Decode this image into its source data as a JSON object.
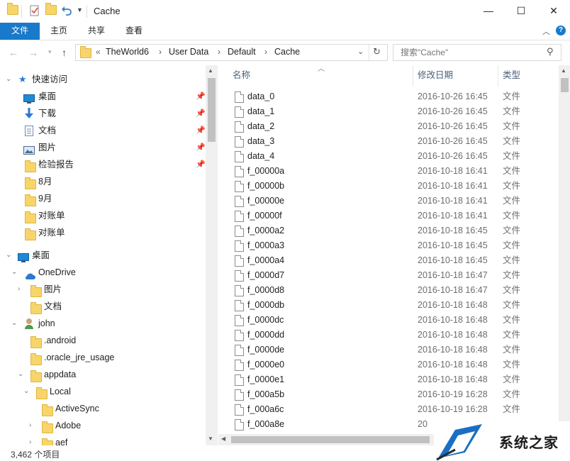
{
  "window": {
    "title": "Cache",
    "controls": {
      "minimize": "—",
      "maximize": "☐",
      "close": "✕"
    }
  },
  "ribbon": {
    "tabs": [
      "文件",
      "主页",
      "共享",
      "查看"
    ],
    "expand_icon": "chevron-up-icon",
    "help_icon": "help-icon"
  },
  "address": {
    "overflow": "«",
    "breadcrumbs": [
      "TheWorld6",
      "User Data",
      "Default",
      "Cache"
    ],
    "search_placeholder": "搜索\"Cache\""
  },
  "nav": {
    "quick_access": {
      "label": "快速访问",
      "items": [
        {
          "label": "桌面",
          "icon": "desktop-icon",
          "pinned": true
        },
        {
          "label": "下载",
          "icon": "download-icon",
          "pinned": true
        },
        {
          "label": "文档",
          "icon": "document-icon",
          "pinned": true
        },
        {
          "label": "图片",
          "icon": "picture-icon",
          "pinned": true
        },
        {
          "label": "检验报告",
          "icon": "folder-icon",
          "pinned": true
        },
        {
          "label": "8月",
          "icon": "folder-icon",
          "pinned": false
        },
        {
          "label": "9月",
          "icon": "folder-icon",
          "pinned": false
        },
        {
          "label": "对账单",
          "icon": "folder-icon",
          "pinned": false
        },
        {
          "label": "对账单",
          "icon": "folder-icon",
          "pinned": false
        }
      ]
    },
    "desktop": {
      "label": "桌面"
    },
    "onedrive": {
      "label": "OneDrive",
      "children": [
        "图片",
        "文档"
      ]
    },
    "user": {
      "label": "john"
    },
    "user_children": [
      ".android",
      ".oracle_jre_usage",
      "appdata"
    ],
    "local": {
      "label": "Local"
    },
    "local_children": [
      "ActiveSync",
      "Adobe",
      "aef"
    ]
  },
  "content": {
    "columns": {
      "name": "名称",
      "date": "修改日期",
      "type": "类型"
    },
    "files": [
      {
        "name": "data_0",
        "date": "2016-10-26 16:45",
        "type": "文件"
      },
      {
        "name": "data_1",
        "date": "2016-10-26 16:45",
        "type": "文件"
      },
      {
        "name": "data_2",
        "date": "2016-10-26 16:45",
        "type": "文件"
      },
      {
        "name": "data_3",
        "date": "2016-10-26 16:45",
        "type": "文件"
      },
      {
        "name": "data_4",
        "date": "2016-10-26 16:45",
        "type": "文件"
      },
      {
        "name": "f_00000a",
        "date": "2016-10-18 16:41",
        "type": "文件"
      },
      {
        "name": "f_00000b",
        "date": "2016-10-18 16:41",
        "type": "文件"
      },
      {
        "name": "f_00000e",
        "date": "2016-10-18 16:41",
        "type": "文件"
      },
      {
        "name": "f_00000f",
        "date": "2016-10-18 16:41",
        "type": "文件"
      },
      {
        "name": "f_0000a2",
        "date": "2016-10-18 16:45",
        "type": "文件"
      },
      {
        "name": "f_0000a3",
        "date": "2016-10-18 16:45",
        "type": "文件"
      },
      {
        "name": "f_0000a4",
        "date": "2016-10-18 16:45",
        "type": "文件"
      },
      {
        "name": "f_0000d7",
        "date": "2016-10-18 16:47",
        "type": "文件"
      },
      {
        "name": "f_0000d8",
        "date": "2016-10-18 16:47",
        "type": "文件"
      },
      {
        "name": "f_0000db",
        "date": "2016-10-18 16:48",
        "type": "文件"
      },
      {
        "name": "f_0000dc",
        "date": "2016-10-18 16:48",
        "type": "文件"
      },
      {
        "name": "f_0000dd",
        "date": "2016-10-18 16:48",
        "type": "文件"
      },
      {
        "name": "f_0000de",
        "date": "2016-10-18 16:48",
        "type": "文件"
      },
      {
        "name": "f_0000e0",
        "date": "2016-10-18 16:48",
        "type": "文件"
      },
      {
        "name": "f_0000e1",
        "date": "2016-10-18 16:48",
        "type": "文件"
      },
      {
        "name": "f_000a5b",
        "date": "2016-10-19 16:28",
        "type": "文件"
      },
      {
        "name": "f_000a6c",
        "date": "2016-10-19 16:28",
        "type": "文件"
      },
      {
        "name": "f_000a8e",
        "date": "20",
        "type": ""
      }
    ]
  },
  "status": {
    "item_count": "3,462 个项目"
  },
  "watermark": {
    "text": "系统之家"
  },
  "colors": {
    "accent": "#1979ca",
    "folder": "#f7d56a",
    "header_text": "#4c607a"
  }
}
